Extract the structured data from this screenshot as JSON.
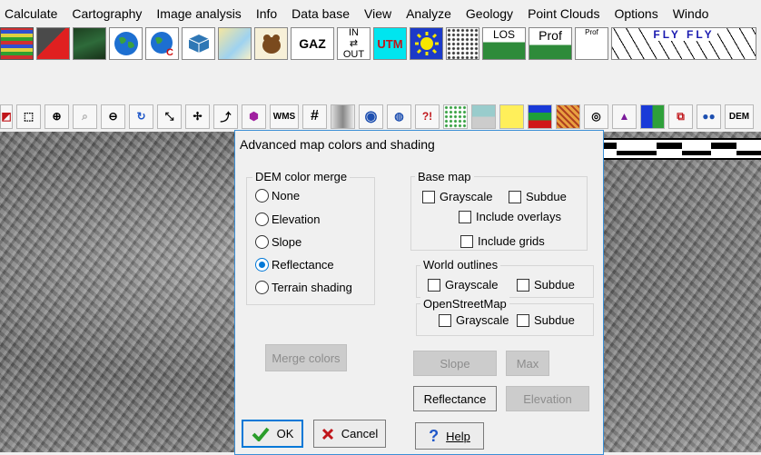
{
  "menubar": {
    "items": [
      "Calculate",
      "Cartography",
      "Image analysis",
      "Info",
      "Data base",
      "View",
      "Analyze",
      "Geology",
      "Point Clouds",
      "Options",
      "Windo"
    ]
  },
  "big_toolbar": {
    "gaz_label": "GAZ",
    "inout_top": "IN",
    "inout_bottom": "OUT",
    "utm_label": "UTM",
    "los_label": "LOS",
    "prof_label": "Prof",
    "prof_small_label": "Prof",
    "fly_label": "FLY FLY"
  },
  "small_toolbar": {
    "wms_label": "WMS",
    "dem_label": "DEM"
  },
  "dialog": {
    "title": "Advanced  map colors and shading",
    "dem_merge": {
      "legend": "DEM color merge",
      "options": [
        "None",
        "Elevation",
        "Slope",
        "Reflectance",
        "Terrain shading"
      ],
      "selected": "Reflectance"
    },
    "merge_colors_label": "Merge colors",
    "base_map": {
      "legend": "Base map",
      "grayscale": "Grayscale",
      "subdue": "Subdue",
      "include_overlays": "Include overlays",
      "include_grids": "Include grids"
    },
    "world_outlines": {
      "legend": "World outlines",
      "grayscale": "Grayscale",
      "subdue": "Subdue"
    },
    "openstreetmap": {
      "legend": "OpenStreetMap",
      "grayscale": "Grayscale",
      "subdue": "Subdue"
    },
    "buttons": {
      "slope": "Slope",
      "max": "Max",
      "reflectance": "Reflectance",
      "elevation": "Elevation",
      "ok": "OK",
      "cancel": "Cancel",
      "help": "Help"
    }
  },
  "colors": {
    "accent": "#0078d7",
    "dialog_border": "#3b8fd6",
    "ok_check": "#2a9d2a",
    "cancel_x": "#c0161b",
    "help_mark": "#1f57c9"
  }
}
